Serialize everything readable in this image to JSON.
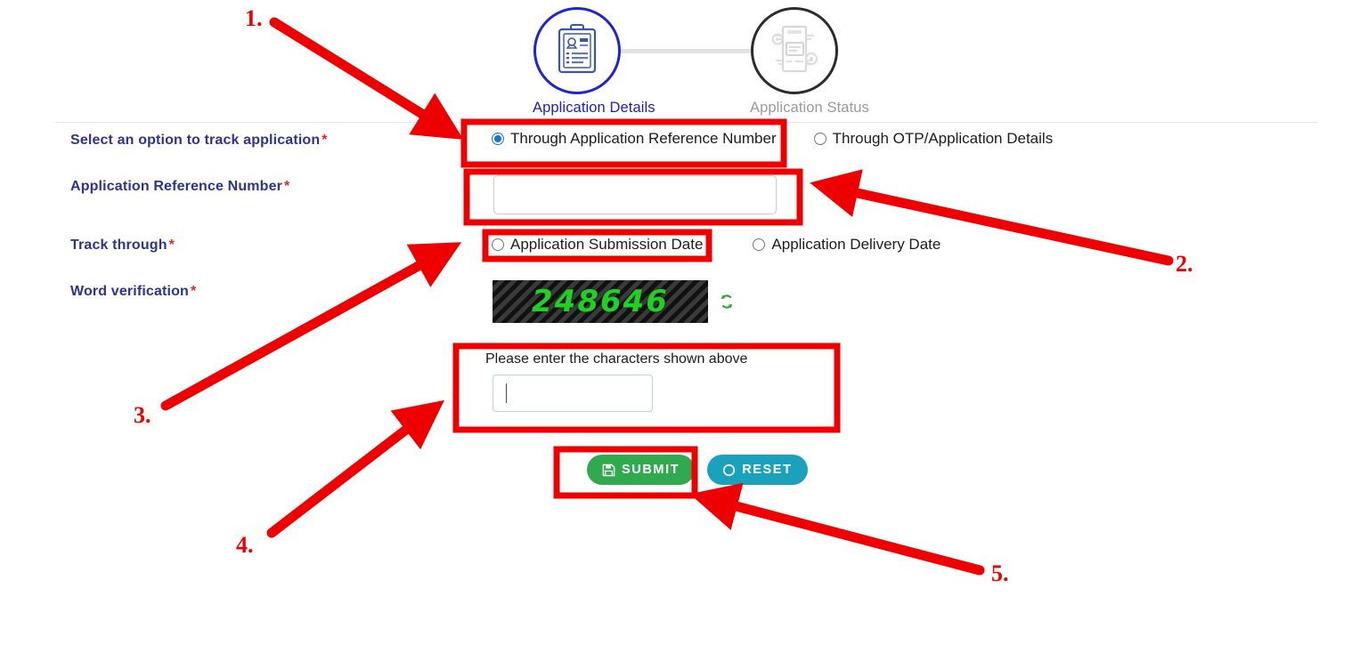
{
  "stepper": {
    "steps": [
      {
        "label": "Application Details",
        "state": "active",
        "icon": "clipboard-form-icon"
      },
      {
        "label": "Application Status",
        "state": "inactive",
        "icon": "document-gears-icon"
      }
    ]
  },
  "form": {
    "fields": {
      "track_option": {
        "label": "Select an option to track application",
        "required_mark": "*",
        "options": [
          {
            "text": "Through Application Reference Number",
            "selected": true
          },
          {
            "text": "Through OTP/Application Details",
            "selected": false
          }
        ]
      },
      "reference_number": {
        "label": "Application Reference Number",
        "required_mark": "*",
        "value": "",
        "placeholder": ""
      },
      "track_through": {
        "label": "Track through",
        "required_mark": "*",
        "options": [
          {
            "text": "Application Submission Date",
            "selected": false
          },
          {
            "text": "Application Delivery Date",
            "selected": false
          }
        ]
      },
      "word_verification": {
        "label": "Word verification",
        "required_mark": "*",
        "captcha_text": "248646",
        "refresh_icon": "refresh-icon",
        "prompt": "Please enter the characters shown above",
        "value": "",
        "placeholder": ""
      }
    },
    "buttons": {
      "submit": {
        "label": "SUBMIT",
        "icon": "save-icon"
      },
      "reset": {
        "label": "RESET",
        "icon": "circle-reset-icon"
      }
    }
  },
  "annotations": {
    "markers": [
      {
        "number": "1."
      },
      {
        "number": "2."
      },
      {
        "number": "3."
      },
      {
        "number": "4."
      },
      {
        "number": "5."
      }
    ]
  },
  "colors": {
    "label_blue": "#2c3490",
    "required_red": "#e8252a",
    "step_active": "#1a1fc4",
    "step_inactive": "#9a9a9a",
    "radio_selected": "#1673d8",
    "captcha_green": "#1fd221",
    "submit_green": "#2faa4f",
    "reset_teal": "#1aa2bd",
    "annotation_red": "#ee0000"
  }
}
